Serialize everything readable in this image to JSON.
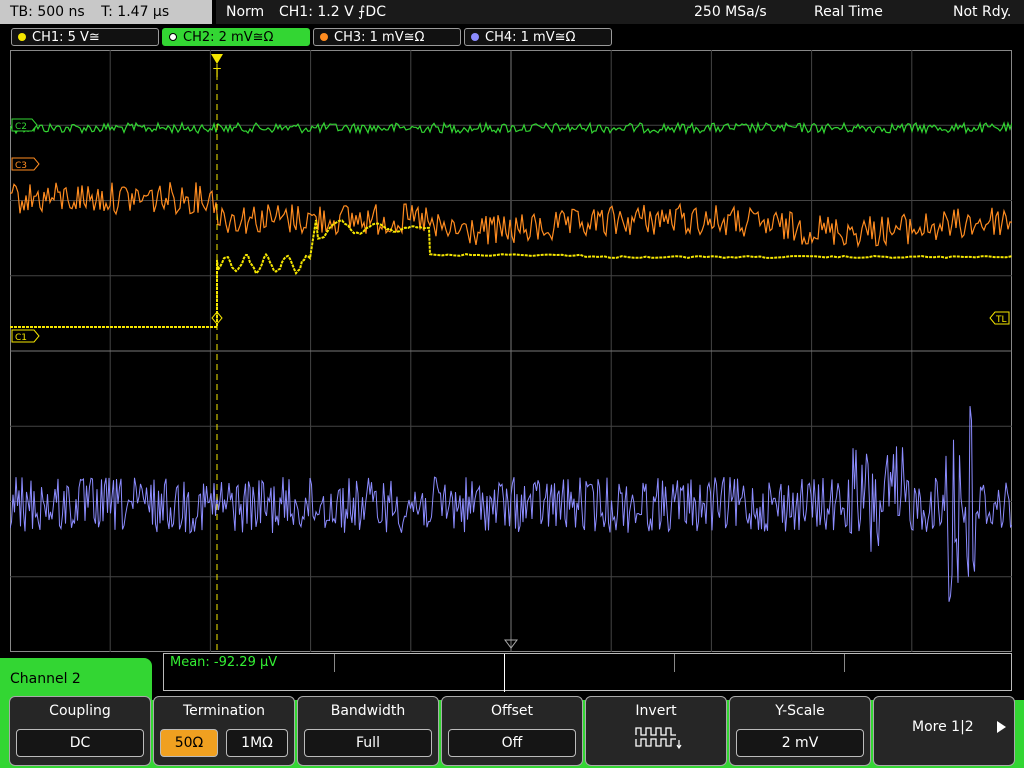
{
  "status_bar": {
    "timebase": "TB: 500 ns",
    "trigger_time": "T: 1.47 µs",
    "trigger_mode": "Norm",
    "trigger_info": "CH1: 1.2 V ⨍DC",
    "sample_rate": "250 MSa/s",
    "acq_mode": "Real Time",
    "trigger_status": "Not Rdy."
  },
  "channel_tabs": [
    {
      "label": "CH1: 5 V≅",
      "color": "#f5e600"
    },
    {
      "label": "CH2: 2 mV≅Ω",
      "color": "#33d633"
    },
    {
      "label": "CH3: 1 mV≅Ω",
      "color": "#ff8c20"
    },
    {
      "label": "CH4: 1 mV≅Ω",
      "color": "#8c8cff"
    }
  ],
  "markers": {
    "c2": "C2",
    "c3": "C3",
    "c1": "C1",
    "tl": "TL",
    "t": "T"
  },
  "colors": {
    "ch1": "#f5e600",
    "ch2": "#33d633",
    "ch3": "#ff8c20",
    "ch4": "#8c8cff",
    "grid": "#555555"
  },
  "measurement": {
    "mean": "Mean: -92.29 µV"
  },
  "active_channel": "Channel 2",
  "softkeys": [
    {
      "label": "Coupling",
      "value": "DC"
    },
    {
      "label": "Termination",
      "values": [
        "50Ω",
        "1MΩ"
      ],
      "selected": 0
    },
    {
      "label": "Bandwidth",
      "value": "Full"
    },
    {
      "label": "Offset",
      "value": "Off"
    },
    {
      "label": "Invert",
      "icon": "invert-waveform-icon"
    },
    {
      "label": "Y-Scale",
      "value": "2 mV"
    },
    {
      "label": "More 1|2",
      "icon": "arrow-right-icon"
    }
  ]
}
